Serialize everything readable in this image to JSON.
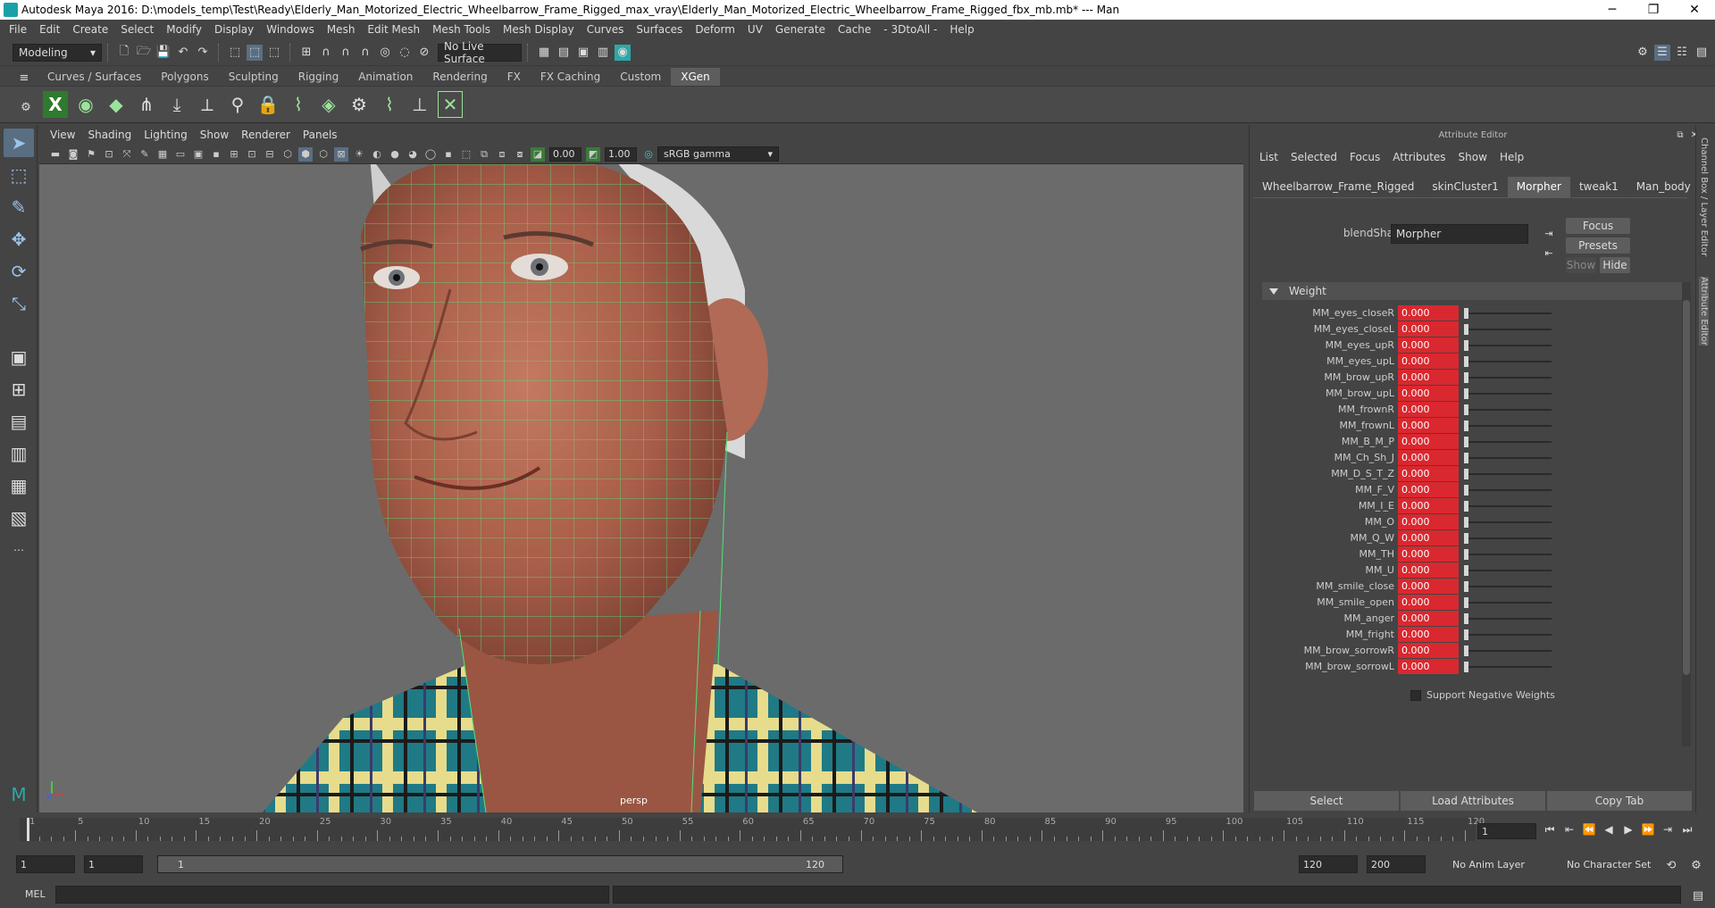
{
  "window": {
    "title": "Autodesk Maya 2016: D:\\models_temp\\Test\\Ready\\Elderly_Man_Motorized_Electric_Wheelbarrow_Frame_Rigged_max_vray\\Elderly_Man_Motorized_Electric_Wheelbarrow_Frame_Rigged_fbx_mb.mb*  ---  Man",
    "minimize": "─",
    "maximize": "❐",
    "close": "✕"
  },
  "menubar": [
    "File",
    "Edit",
    "Create",
    "Select",
    "Modify",
    "Display",
    "Windows",
    "Mesh",
    "Edit Mesh",
    "Mesh Tools",
    "Mesh Display",
    "Curves",
    "Surfaces",
    "Deform",
    "UV",
    "Generate",
    "Cache",
    "- 3DtoAll -",
    "Help"
  ],
  "statusline": {
    "mode": "Modeling",
    "live_surface": "No Live Surface"
  },
  "shelf": {
    "tabs": [
      "Curves / Surfaces",
      "Polygons",
      "Sculpting",
      "Rigging",
      "Animation",
      "Rendering",
      "FX",
      "FX Caching",
      "Custom",
      "XGen"
    ],
    "active_tab": "XGen"
  },
  "viewport": {
    "menu": [
      "View",
      "Shading",
      "Lighting",
      "Show",
      "Renderer",
      "Panels"
    ],
    "exposure": "0.00",
    "gamma": "1.00",
    "color_space": "sRGB gamma",
    "camera_label": "persp"
  },
  "attribute_editor": {
    "title": "Attribute Editor",
    "menu": [
      "List",
      "Selected",
      "Focus",
      "Attributes",
      "Show",
      "Help"
    ],
    "tabs": [
      "Wheelbarrow_Frame_Rigged",
      "skinCluster1",
      "Morpher",
      "tweak1",
      "Man_body"
    ],
    "active_tab": "Morpher",
    "blendshape_label": "blendShape:",
    "blendshape_value": "Morpher",
    "focus_button": "Focus",
    "presets_button": "Presets",
    "show_button": "Show",
    "hide_button": "Hide",
    "weight_section": "Weight",
    "weights": [
      {
        "name": "MM_eyes_closeR",
        "value": "0.000"
      },
      {
        "name": "MM_eyes_closeL",
        "value": "0.000"
      },
      {
        "name": "MM_eyes_upR",
        "value": "0.000"
      },
      {
        "name": "MM_eyes_upL",
        "value": "0.000"
      },
      {
        "name": "MM_brow_upR",
        "value": "0.000"
      },
      {
        "name": "MM_brow_upL",
        "value": "0.000"
      },
      {
        "name": "MM_frownR",
        "value": "0.000"
      },
      {
        "name": "MM_frownL",
        "value": "0.000"
      },
      {
        "name": "MM_B_M_P",
        "value": "0.000"
      },
      {
        "name": "MM_Ch_Sh_J",
        "value": "0.000"
      },
      {
        "name": "MM_D_S_T_Z",
        "value": "0.000"
      },
      {
        "name": "MM_F_V",
        "value": "0.000"
      },
      {
        "name": "MM_I_E",
        "value": "0.000"
      },
      {
        "name": "MM_O",
        "value": "0.000"
      },
      {
        "name": "MM_Q_W",
        "value": "0.000"
      },
      {
        "name": "MM_TH",
        "value": "0.000"
      },
      {
        "name": "MM_U",
        "value": "0.000"
      },
      {
        "name": "MM_smile_close",
        "value": "0.000"
      },
      {
        "name": "MM_smile_open",
        "value": "0.000"
      },
      {
        "name": "MM_anger",
        "value": "0.000"
      },
      {
        "name": "MM_fright",
        "value": "0.000"
      },
      {
        "name": "MM_brow_sorrowR",
        "value": "0.000"
      },
      {
        "name": "MM_brow_sorrowL",
        "value": "0.000"
      }
    ],
    "support_negative": "Support Negative Weights",
    "bottom_buttons": [
      "Select",
      "Load Attributes",
      "Copy Tab"
    ]
  },
  "side_tabs": [
    "Channel Box / Layer Editor",
    "Attribute Editor"
  ],
  "timeslider": {
    "ticks": [
      1,
      5,
      10,
      15,
      20,
      25,
      30,
      35,
      40,
      45,
      50,
      55,
      60,
      65,
      70,
      75,
      80,
      85,
      90,
      95,
      100,
      105,
      110,
      115,
      120
    ],
    "current_frame": "1"
  },
  "range": {
    "start": "1",
    "playback_start": "1",
    "slider_start": "1",
    "slider_end": "120",
    "playback_end": "120",
    "end": "200",
    "anim_layer": "No Anim Layer",
    "character_set": "No Character Set"
  },
  "cmdline": {
    "label": "MEL"
  }
}
